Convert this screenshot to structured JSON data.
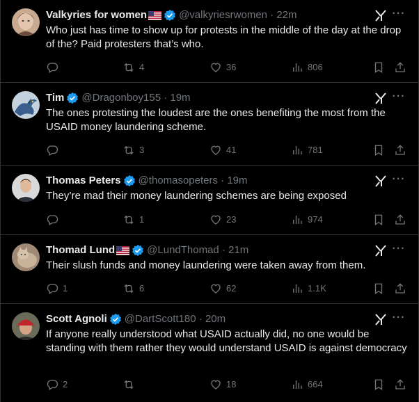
{
  "posts": [
    {
      "name": "Valkyries for women",
      "flag": true,
      "verified": true,
      "handle": "@valkyriesrwomen · 22m",
      "text": "Who just has time to show up for protests in the middle of the day at the drop of the? Paid protesters that’s who.",
      "replies": "",
      "reposts": "4",
      "likes": "36",
      "views": "806",
      "avatar_icon": "woman-portrait",
      "avatar_color": "#c9a98f"
    },
    {
      "name": "Tim",
      "flag": false,
      "verified": true,
      "handle": "@Dragonboy155 · 19m",
      "text": "The ones protesting the loudest are the ones benefiting the most from the USAID money laundering scheme.",
      "replies": "",
      "reposts": "3",
      "likes": "41",
      "views": "781",
      "avatar_icon": "blue-dragon",
      "avatar_color": "#3b5f8c"
    },
    {
      "name": "Thomas Peters",
      "flag": false,
      "verified": true,
      "handle": "@thomasopeters · 19m",
      "text": "They’re mad their money laundering schemes are being exposed",
      "replies": "",
      "reposts": "1",
      "likes": "23",
      "views": "974",
      "avatar_icon": "man-portrait",
      "avatar_color": "#d9d9d9"
    },
    {
      "name": "Thomad Lund",
      "flag": true,
      "verified": true,
      "handle": "@LundThomad · 21m",
      "text": "Their slush funds and money laundering were taken away from them.",
      "replies": "1",
      "reposts": "6",
      "likes": "62",
      "views": "1.1K",
      "avatar_icon": "cat-photo",
      "avatar_color": "#a08a76"
    },
    {
      "name": "Scott Agnoli",
      "flag": false,
      "verified": true,
      "handle": "@DartScott180 · 20m",
      "text": "If anyone really understood what USAID actually did, no one would be standing with them rather they would understand USAID is against democracy",
      "replies": "2",
      "reposts": "",
      "likes": "18",
      "views": "664",
      "avatar_icon": "man-red-cap",
      "avatar_color": "#8a4a3a"
    }
  ],
  "colors": {
    "background": "#000000",
    "text": "#e7e9ea",
    "muted": "#71767b",
    "verified": "#1d9bf0",
    "divider": "#2f3336"
  }
}
